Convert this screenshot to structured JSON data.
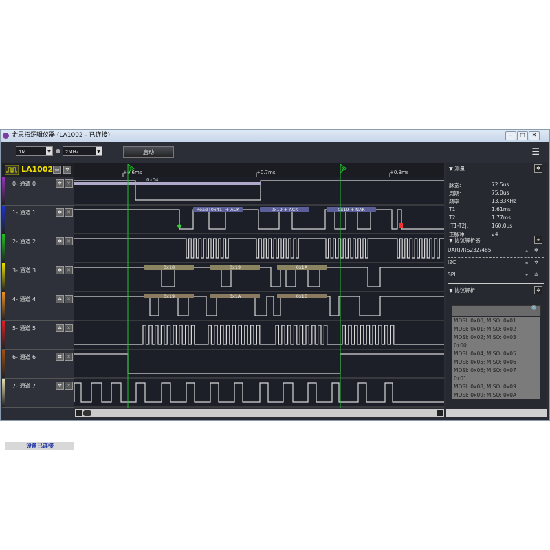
{
  "window": {
    "title": "金思拓逻辑仪器 (LA1002 - 已连接)",
    "minimize": "–",
    "maximize": "□",
    "close": "✕"
  },
  "toolbar": {
    "samples": "1M",
    "rate": "2MHz",
    "start": "启动",
    "menu_icon": "hamburger-icon"
  },
  "device": {
    "name": "LA1002"
  },
  "channels": [
    {
      "label": "0- 通道 0",
      "color": "#9a30c0"
    },
    {
      "label": "1- 通道 1",
      "color": "#2030d0"
    },
    {
      "label": "2- 通道 2",
      "color": "#20c020"
    },
    {
      "label": "3- 通道 3",
      "color": "#e8e000"
    },
    {
      "label": "4- 通道 4",
      "color": "#f09020"
    },
    {
      "label": "5- 通道 5",
      "color": "#e02020"
    },
    {
      "label": "6- 通道 6",
      "color": "#a05010"
    },
    {
      "label": "7- 通道 7",
      "color": "#e8e0b0"
    }
  ],
  "ruler": {
    "ticks": [
      "+0.6ms",
      "+0.7ms",
      "+0.8ms"
    ],
    "cursors": [
      "1",
      "2"
    ]
  },
  "annotations": {
    "ch0": [
      "0x04"
    ],
    "ch1": [
      "Read [0x41] + ACK",
      "0x19 + ACK",
      "0x19 + NAK"
    ],
    "ch3": [
      "0x18",
      "0x19",
      "0x1A"
    ],
    "ch4": [
      "0x19",
      "0x1A",
      "0x1B"
    ]
  },
  "measure": {
    "title": "测量",
    "rows": [
      {
        "k": "脉宽:",
        "v": "72.5us"
      },
      {
        "k": "周期:",
        "v": "75.0us"
      },
      {
        "k": "频率:",
        "v": "13.33KHz"
      },
      {
        "k": "T1:",
        "v": "1.61ms"
      },
      {
        "k": "T2:",
        "v": "1.77ms"
      },
      {
        "k": "|T1-T2|:",
        "v": "160.0us"
      },
      {
        "k": "正脉冲:",
        "v": "24"
      }
    ]
  },
  "analyzers": {
    "title": "协议解析器",
    "items": [
      "UART/RS232/485",
      "I2C",
      "SPI"
    ]
  },
  "decode": {
    "title": "协议解析",
    "search_placeholder": "",
    "rows": [
      "MOSI: 0x00;  MISO: 0x01",
      "MOSI: 0x01;  MISO: 0x02",
      "MOSI: 0x02;  MISO: 0x03",
      "0x00",
      "MOSI: 0x04;  MISO: 0x05",
      "MOSI: 0x05;  MISO: 0x06",
      "MOSI: 0x06;  MISO: 0x07",
      "0x01",
      "MOSI: 0x08;  MISO: 0x09",
      "MOSI: 0x09;  MISO: 0x0A"
    ]
  },
  "status": {
    "text": "设备已连接"
  }
}
